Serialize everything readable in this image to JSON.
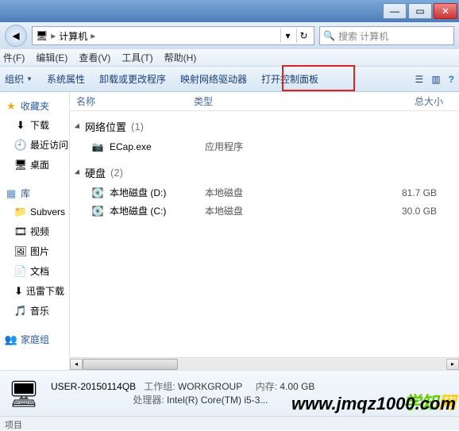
{
  "titlebar": {
    "min": "—",
    "max": "▭",
    "close": "✕"
  },
  "addrbar": {
    "back_glyph": "◀",
    "computer_label": "计算机",
    "sep": "▸",
    "dropdown_glyph": "▾",
    "refresh_glyph": "↻",
    "search_placeholder": "搜索 计算机",
    "search_glyph": "🔍"
  },
  "menubar": {
    "file": "件(F)",
    "edit": "编辑(E)",
    "view": "查看(V)",
    "tools": "工具(T)",
    "help": "帮助(H)"
  },
  "toolbar": {
    "organize": "组织",
    "system_props": "系统属性",
    "uninstall": "卸载或更改程序",
    "map_drive": "映射网络驱动器",
    "control_panel": "打开控制面板",
    "view_glyph": "☰",
    "preview_glyph": "▥",
    "help_glyph": "?"
  },
  "sidebar": {
    "favorites": {
      "label": "收藏夹",
      "items": [
        {
          "icon": "download-icon",
          "glyph": "⬇",
          "label": "下载"
        },
        {
          "icon": "recent-icon",
          "glyph": "🕘",
          "label": "最近访问"
        },
        {
          "icon": "desktop-icon",
          "glyph": "🖥",
          "label": "桌面"
        }
      ]
    },
    "libraries": {
      "label": "库",
      "items": [
        {
          "icon": "folder-icon",
          "glyph": "📁",
          "label": "Subvers"
        },
        {
          "icon": "video-icon",
          "glyph": "🎞",
          "label": "视频"
        },
        {
          "icon": "pictures-icon",
          "glyph": "🖼",
          "label": "图片"
        },
        {
          "icon": "documents-icon",
          "glyph": "📄",
          "label": "文档"
        },
        {
          "icon": "thunder-icon",
          "glyph": "⬇",
          "label": "迅雷下载"
        },
        {
          "icon": "music-icon",
          "glyph": "🎵",
          "label": "音乐"
        }
      ]
    },
    "homegroup": {
      "label": "家庭组",
      "glyph": "👥"
    }
  },
  "columns": {
    "name": "名称",
    "type": "类型",
    "size": "总大小"
  },
  "groups": [
    {
      "title": "网络位置",
      "count": "(1)",
      "items": [
        {
          "icon": "app-icon",
          "glyph": "📷",
          "name": "ECap.exe",
          "type": "应用程序",
          "size": ""
        }
      ]
    },
    {
      "title": "硬盘",
      "count": "(2)",
      "items": [
        {
          "icon": "drive-icon",
          "glyph": "💽",
          "name": "本地磁盘 (D:)",
          "type": "本地磁盘",
          "size": "81.7 GB"
        },
        {
          "icon": "drive-icon",
          "glyph": "💽",
          "name": "本地磁盘 (C:)",
          "type": "本地磁盘",
          "size": "30.0 GB"
        }
      ]
    }
  ],
  "details": {
    "computer_name": "USER-20150114QB",
    "workgroup_label": "工作组:",
    "workgroup": "WORKGROUP",
    "memory_label": "内存:",
    "memory": "4.00 GB",
    "cpu_label": "处理器:",
    "cpu": "Intel(R) Core(TM) i5-3..."
  },
  "statusbar": {
    "text": "项目"
  },
  "watermark": {
    "text1": "学知",
    "text2": "网",
    "url": "www.jmqz1000.com"
  }
}
